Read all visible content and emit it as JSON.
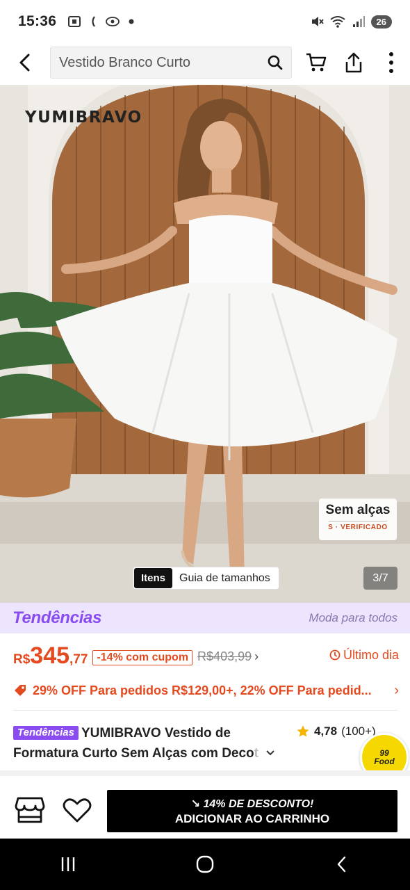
{
  "status_bar": {
    "time": "15:36",
    "battery": "26"
  },
  "header": {
    "search_value": "Vestido Branco Curto"
  },
  "product_image": {
    "brand_watermark": "YUMIBRAVO",
    "feature_title": "Sem alças",
    "feature_subtitle": "S · VERIFICADO",
    "itens_label": "Itens",
    "size_guide_label": "Guia de tamanhos",
    "image_counter": "3/7"
  },
  "trend_banner": {
    "logo": "Tendências",
    "tagline": "Moda para todos"
  },
  "price": {
    "currency": "R$",
    "integer": "345",
    "decimal": ",77",
    "discount_badge": "-14% com cupom",
    "original_price": "R$403,99",
    "last_day_label": "Último dia"
  },
  "promo": {
    "text": "29% OFF Para pedidos R$129,00+,  22% OFF Para pedid..."
  },
  "title": {
    "trend_chip": "Tendências",
    "text_main": "YUMIBRAVO Vestido de Formatura Curto Sem Alças com Deco",
    "text_fade": "t"
  },
  "rating": {
    "value": "4,78",
    "count": "(100+)"
  },
  "food_bubble": {
    "line1": "99",
    "line2": "Food"
  },
  "action_bar": {
    "cart_promo": "↘ 14% DE DESCONTO!",
    "cart_label": "ADICIONAR AO CARRINHO"
  },
  "colors": {
    "accent_orange": "#e34a1f",
    "trend_purple": "#8a4bf0",
    "banner_bg": "#ece5fd"
  },
  "icons": [
    "back-arrow-icon",
    "search-icon",
    "cart-icon",
    "share-icon",
    "more-vertical-icon",
    "store-icon",
    "heart-icon",
    "tag-icon",
    "clock-icon",
    "star-icon",
    "chevron-down-icon",
    "recents-icon",
    "home-icon",
    "nav-back-icon"
  ]
}
